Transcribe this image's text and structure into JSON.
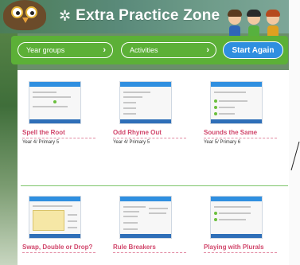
{
  "header": {
    "title": "Extra Practice Zone",
    "sparkle_icon": "sparkle-icon"
  },
  "filters": {
    "year_groups": "Year groups",
    "activities": "Activities",
    "start_again": "Start Again",
    "bar_color": "#5cb037",
    "button_color": "#2f8fe0"
  },
  "activities": [
    {
      "title": "Spell the Root",
      "year": "Year 4/ Primary 5"
    },
    {
      "title": "Odd Rhyme Out",
      "year": "Year 4/ Primary 5"
    },
    {
      "title": "Sounds the Same",
      "year": "Year 5/ Primary 6"
    },
    {
      "title": "Swap, Double or Drop?",
      "year": ""
    },
    {
      "title": "Rule Breakers",
      "year": ""
    },
    {
      "title": "Playing with Plurals",
      "year": ""
    }
  ]
}
